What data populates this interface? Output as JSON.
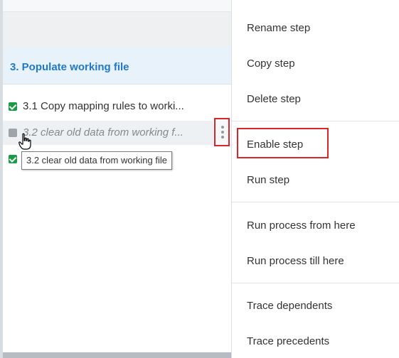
{
  "section": {
    "title": "3. Populate working file"
  },
  "steps": [
    {
      "label": "3.1 Copy mapping rules to worki...",
      "state": "enabled"
    },
    {
      "label": "3.2 clear old data from working f...",
      "state": "disabled"
    },
    {
      "label": "",
      "state": "enabled"
    }
  ],
  "tooltip": {
    "text": "3.2 clear old data from working file"
  },
  "context_menu": {
    "items": [
      {
        "label": "Rename step"
      },
      {
        "label": "Copy step"
      },
      {
        "label": "Delete step"
      },
      {
        "label": "Enable step"
      },
      {
        "label": "Run step"
      },
      {
        "label": "Run process from here"
      },
      {
        "label": "Run process till here"
      },
      {
        "label": "Trace dependents"
      },
      {
        "label": "Trace precedents"
      }
    ]
  },
  "colors": {
    "accent": "#1f78c8",
    "checked": "#1a9b45",
    "disabled_box": "#9ea4aa",
    "highlight_border": "#d9262c"
  },
  "icons": [
    "checkbox-checked-icon",
    "checkbox-disabled-icon",
    "more-vertical-icon",
    "hand-cursor-icon"
  ]
}
